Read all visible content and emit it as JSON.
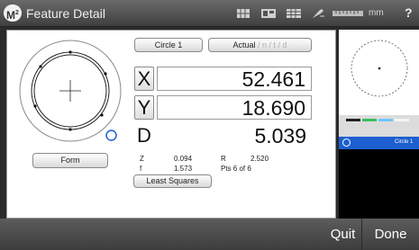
{
  "titlebar": {
    "logo_letter": "M",
    "logo_superscript": "2",
    "title": "Feature Detail",
    "units": "mm",
    "help": "?"
  },
  "feature": {
    "name_button": "Circle 1",
    "mode_button_active": "Actual",
    "mode_button_dim": " / n / t / d",
    "form_button": "Form",
    "fit_button": "Least Squares"
  },
  "values": {
    "x_label": "X",
    "x_value": "52.461",
    "y_label": "Y",
    "y_value": "18.690",
    "d_label": "D",
    "d_value": "5.039"
  },
  "stats": {
    "z_label": "Z",
    "z_value": "0.094",
    "r_label": "R",
    "r_value": "2.520",
    "f_label": "f",
    "f_value": "1.573",
    "pts": "Pts 6 of 6"
  },
  "feature_list": {
    "selected_item": "Circle 1"
  },
  "bottombar": {
    "quit": "Quit",
    "done": "Done"
  },
  "colors": {
    "selection_blue": "#1d5fd0",
    "title_bar": "#4a4a4a"
  }
}
